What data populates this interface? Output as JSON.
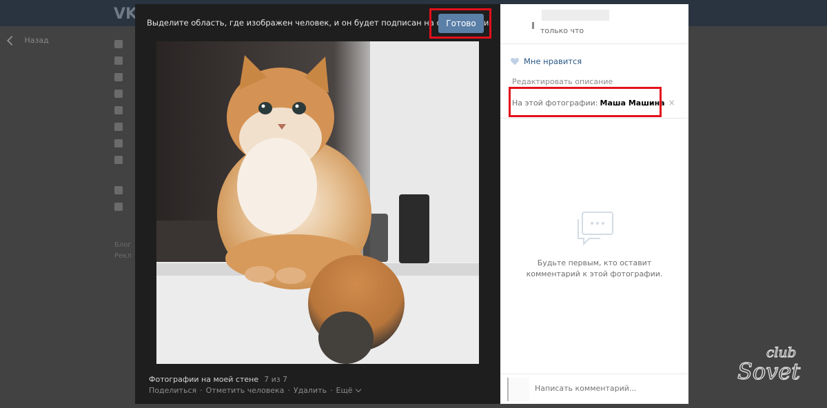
{
  "background_page": {
    "logo": "VK",
    "back_label": "Назад",
    "footer_links": [
      "Блог",
      "Рекл"
    ]
  },
  "tagging": {
    "hint": "Выделите область, где изображен человек, и он будет подписан на фотографии.",
    "done_label": "Готово"
  },
  "photo": {
    "album": "Фотографии на моей стене",
    "position": "7 из 7",
    "actions": [
      "Поделиться",
      "Отметить человека",
      "Удалить",
      "Ещё"
    ]
  },
  "panel": {
    "author_subtitle": "только что",
    "like_label": "Мне нравится",
    "edit_description": "Редактировать описание",
    "on_photo_label": "На этой фотографии:",
    "tagged_person": "Маша Машина",
    "remove_tag_glyph": "×",
    "empty_comments": "Будьте первым, кто оставит комментарий к этой фотографии.",
    "comment_placeholder": "Написать комментарий..."
  },
  "watermark": {
    "top": "club",
    "bottom": "Sovet"
  },
  "colors": {
    "accent": "#5b80a8",
    "link": "#2a5885",
    "highlight": "#e3101a"
  }
}
